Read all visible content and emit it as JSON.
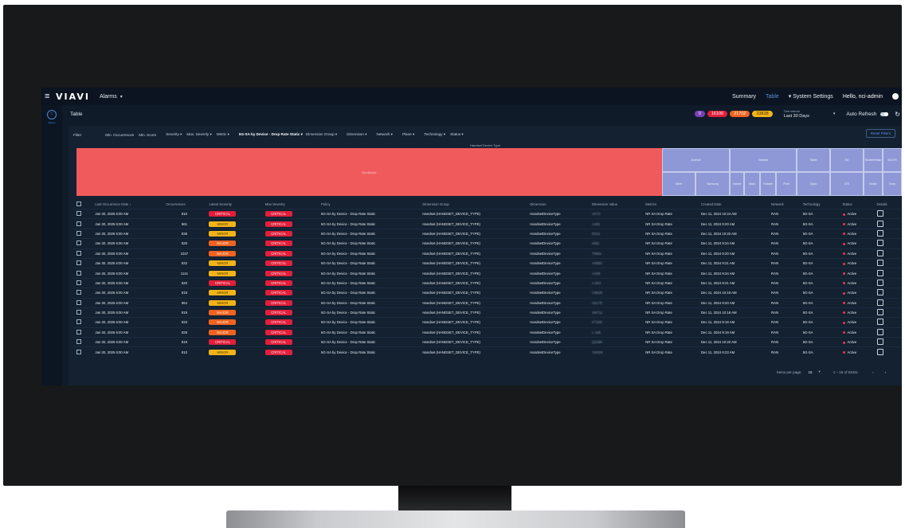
{
  "app": {
    "logo": "VIAVI",
    "name": "Alarms"
  },
  "topnav": {
    "summary": "Summary",
    "table": "Table",
    "settings": "System Settings",
    "user": "Hello, nci-admin"
  },
  "sidebar": {
    "label": "Alarms"
  },
  "page": {
    "title": "Table",
    "badges": [
      {
        "value": "0",
        "color": "#7b3fb5"
      },
      {
        "value": "16100",
        "color": "#e01f3b"
      },
      {
        "value": "21702",
        "color": "#ee6320"
      },
      {
        "value": "23828",
        "color": "#f2b318"
      }
    ],
    "time_interval_label": "Time interval",
    "time_interval_value": "Last 30 Days",
    "auto_refresh": "Auto Refresh"
  },
  "filters": {
    "label": "Filter",
    "items": [
      "Min. Occurrences",
      "Min. Score",
      "Severity ▾",
      "Max. Severity ▾",
      "Metric ▾",
      "5G-SA by Device - Drop Rate Static ▾",
      "Dimension Group ▾",
      "Dimension ▾",
      "Network ▾",
      "Plane ▾",
      "Technology ▾",
      "Status ▾"
    ],
    "reset": "Reset Filters"
  },
  "treemap": {
    "title": "Handset Device Type",
    "big": "ios-device",
    "cells": [
      "Android",
      "Generic",
      "Tablet",
      "5G",
      "Router/Hotsp",
      "5G/LTE",
      "Other",
      "Samsung",
      "Xiaomi",
      "Moto",
      "Huawei",
      "Pixel",
      "Oppo",
      "ZTE",
      "Nokia",
      "Sony"
    ]
  },
  "table": {
    "columns": [
      "Last Occurrence Date ↓",
      "Occurrences",
      "Latest Severity",
      "Max Severity",
      "Policy",
      "Dimension Group",
      "Dimension",
      "Dimension Value",
      "Metrics",
      "Created Date",
      "Network",
      "Technology",
      "Status",
      "Details"
    ],
    "rows": [
      {
        "date": "Jan 30, 2025 6:00 AM",
        "occ": "810",
        "latest": "CRITICAL",
        "max": "CRITICAL",
        "policy": "5G-SA by Device - Drop Rate Static",
        "group": "Handset (HANDSET_DEVICE_TYPE)",
        "dim": "HandsetDeviceType",
        "val": "VE70",
        "metric": "NR SA Drop Rate",
        "created": "Dec 11, 2024 10:24 AM",
        "net": "RAN",
        "tech": "5G-SA",
        "status": "Active"
      },
      {
        "date": "Jan 30, 2025 6:00 AM",
        "occ": "961",
        "latest": "MINOR",
        "max": "CRITICAL",
        "policy": "5G-SA by Device - Drop Rate Static",
        "group": "Handset (HANDSET_DEVICE_TYPE)",
        "dim": "HandsetDeviceType",
        "val": "A465",
        "metric": "NR SA Drop Rate",
        "created": "Dec 11, 2024 9:20 AM",
        "net": "RAN",
        "tech": "5G-SA",
        "status": "Active"
      },
      {
        "date": "Jan 30, 2025 6:00 AM",
        "occ": "836",
        "latest": "MINOR",
        "max": "CRITICAL",
        "policy": "5G-SA by Device - Drop Rate Static",
        "group": "Handset (HANDSET_DEVICE_TYPE)",
        "dim": "HandsetDeviceType",
        "val": "E616",
        "metric": "NR SA Drop Rate",
        "created": "Dec 11, 2024 10:20 AM",
        "net": "RAN",
        "tech": "5G-SA",
        "status": "Active"
      },
      {
        "date": "Jan 30, 2025 6:00 AM",
        "occ": "825",
        "latest": "MAJOR",
        "max": "CRITICAL",
        "policy": "5G-SA by Device - Drop Rate Static",
        "group": "Handset (HANDSET_DEVICE_TYPE)",
        "dim": "HandsetDeviceType",
        "val": "e981",
        "metric": "NR SA Drop Rate",
        "created": "Dec 11, 2024 9:24 AM",
        "net": "RAN",
        "tech": "5G-SA",
        "status": "Active"
      },
      {
        "date": "Jan 30, 2025 6:00 AM",
        "occ": "1037",
        "latest": "MAJOR",
        "max": "CRITICAL",
        "policy": "5G-SA by Device - Drop Rate Static",
        "group": "Handset (HANDSET_DEVICE_TYPE)",
        "dim": "HandsetDeviceType",
        "val": "T685s",
        "metric": "NR SA Drop Rate",
        "created": "Dec 11, 2024 9:20 AM",
        "net": "RAN",
        "tech": "5G-SA",
        "status": "Active"
      },
      {
        "date": "Jan 30, 2025 6:00 AM",
        "occ": "832",
        "latest": "MINOR",
        "max": "CRITICAL",
        "policy": "5G-SA by Device - Drop Rate Static",
        "group": "Handset (HANDSET_DEVICE_TYPE)",
        "dim": "HandsetDeviceType",
        "val": "A00BC",
        "metric": "NR SA Drop Rate",
        "created": "Dec 11, 2024 9:21 AM",
        "net": "RAN",
        "tech": "5G-SA",
        "status": "Active"
      },
      {
        "date": "Jan 30, 2025 6:00 AM",
        "occ": "1141",
        "latest": "MINOR",
        "max": "CRITICAL",
        "policy": "5G-SA by Device - Drop Rate Static",
        "group": "Handset (HANDSET_DEVICE_TYPE)",
        "dim": "HandsetDeviceType",
        "val": "A34B",
        "metric": "NR SA Drop Rate",
        "created": "Dec 11, 2024 9:24 AM",
        "net": "RAN",
        "tech": "5G-SA",
        "status": "Active"
      },
      {
        "date": "Jan 30, 2025 6:00 AM",
        "occ": "820",
        "latest": "CRITICAL",
        "max": "CRITICAL",
        "policy": "5G-SA by Device - Drop Rate Static",
        "group": "Handset (HANDSET_DEVICE_TYPE)",
        "dim": "HandsetDeviceType",
        "val": "A-503",
        "metric": "NR SA Drop Rate",
        "created": "Dec 11, 2024 9:21 AM",
        "net": "RAN",
        "tech": "5G-SA",
        "status": "Active"
      },
      {
        "date": "Jan 30, 2025 6:00 AM",
        "occ": "819",
        "latest": "MINOR",
        "max": "CRITICAL",
        "policy": "5G-SA by Device - Drop Rate Static",
        "group": "Handset (HANDSET_DEVICE_TYPE)",
        "dim": "HandsetDeviceType",
        "val": "CB62E",
        "metric": "NR SA Drop Rate",
        "created": "Dec 11, 2024 10:18 AM",
        "net": "RAN",
        "tech": "5G-SA",
        "status": "Active"
      },
      {
        "date": "Jan 30, 2025 6:00 AM",
        "occ": "964",
        "latest": "MINOR",
        "max": "CRITICAL",
        "policy": "5G-SA by Device - Drop Rate Static",
        "group": "Handset (HANDSET_DEVICE_TYPE)",
        "dim": "HandsetDeviceType",
        "val": "G817E",
        "metric": "NR SA Drop Rate",
        "created": "Dec 11, 2024 9:20 AM",
        "net": "RAN",
        "tech": "5G-SA",
        "status": "Active"
      },
      {
        "date": "Jan 30, 2025 6:00 AM",
        "occ": "819",
        "latest": "MAJOR",
        "max": "CRITICAL",
        "policy": "5G-SA by Device - Drop Rate Static",
        "group": "Handset (HANDSET_DEVICE_TYPE)",
        "dim": "HandsetDeviceType",
        "val": "SM711",
        "metric": "NR SA Drop Rate",
        "created": "Dec 11, 2024 10:18 AM",
        "net": "RAN",
        "tech": "5G-SA",
        "status": "Active"
      },
      {
        "date": "Jan 30, 2025 6:00 AM",
        "occ": "833",
        "latest": "MAJOR",
        "max": "CRITICAL",
        "policy": "5G-SA by Device - Drop Rate Static",
        "group": "Handset (HANDSET_DEVICE_TYPE)",
        "dim": "HandsetDeviceType",
        "val": "KT208",
        "metric": "NR SA Drop Rate",
        "created": "Dec 11, 2024 9:18 AM",
        "net": "RAN",
        "tech": "5G-SA",
        "status": "Active"
      },
      {
        "date": "Jan 30, 2025 6:00 AM",
        "occ": "829",
        "latest": "MAJOR",
        "max": "CRITICAL",
        "policy": "5G-SA by Device - Drop Rate Static",
        "group": "Handset (HANDSET_DEVICE_TYPE)",
        "dim": "HandsetDeviceType",
        "val": "L-19E",
        "metric": "NR SA Drop Rate",
        "created": "Dec 11, 2024 9:19 AM",
        "net": "RAN",
        "tech": "5G-SA",
        "status": "Active"
      },
      {
        "date": "Jan 30, 2025 6:00 AM",
        "occ": "819",
        "latest": "CRITICAL",
        "max": "CRITICAL",
        "policy": "5G-SA by Device - Drop Rate Static",
        "group": "Handset (HANDSET_DEVICE_TYPE)",
        "dim": "HandsetDeviceType",
        "val": "Q2598",
        "metric": "NR SA Drop Rate",
        "created": "Dec 11, 2024 10:20 AM",
        "net": "RAN",
        "tech": "5G-SA",
        "status": "Active"
      },
      {
        "date": "Jan 30, 2025 6:00 AM",
        "occ": "810",
        "latest": "MINOR",
        "max": "CRITICAL",
        "policy": "5G-SA by Device - Drop Rate Static",
        "group": "Handset (HANDSET_DEVICE_TYPE)",
        "dim": "HandsetDeviceType",
        "val": "YM308",
        "metric": "NR SA Drop Rate",
        "created": "Dec 11, 2024 9:23 AM",
        "net": "RAN",
        "tech": "5G-SA",
        "status": "Active"
      }
    ]
  },
  "pagination": {
    "label": "Items per page:",
    "per_page": "15",
    "range": "1 – 15 of 63341"
  }
}
